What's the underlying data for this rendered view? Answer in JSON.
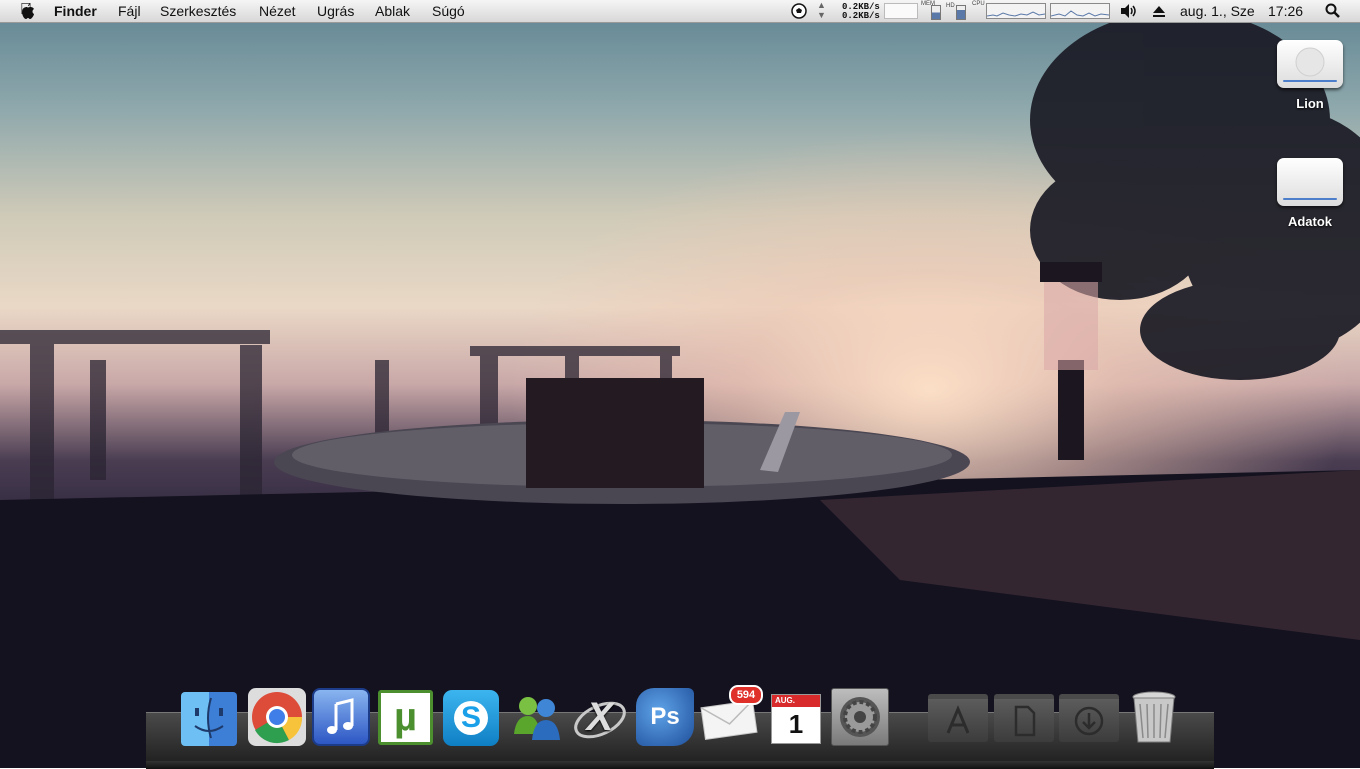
{
  "menubar": {
    "app_name": "Finder",
    "items": [
      "Fájl",
      "Szerkesztés",
      "Nézet",
      "Ugrás",
      "Ablak",
      "Súgó"
    ],
    "net_down": "0.2KB/s",
    "net_up": "0.2KB/s",
    "mem_label": "MEM",
    "hd_label": "HD",
    "cpu_label": "CPU",
    "date": "aug. 1., Sze",
    "time": "17:26"
  },
  "desktop": {
    "drives": [
      {
        "label": "Lion"
      },
      {
        "label": "Adatok"
      }
    ]
  },
  "dock": {
    "apps": [
      {
        "name": "Finder",
        "icon": "finder-icon"
      },
      {
        "name": "Google Chrome",
        "icon": "chrome-icon"
      },
      {
        "name": "iTunes",
        "icon": "itunes-icon"
      },
      {
        "name": "uTorrent",
        "icon": "utorrent-icon",
        "glyph": "µ"
      },
      {
        "name": "Skype",
        "icon": "skype-icon",
        "glyph": "S"
      },
      {
        "name": "Messenger",
        "icon": "messenger-icon"
      },
      {
        "name": "CrossOver",
        "icon": "crossover-icon",
        "glyph": "X"
      },
      {
        "name": "Photoshop",
        "icon": "photoshop-icon",
        "glyph": "Ps"
      },
      {
        "name": "Mail",
        "icon": "mail-icon",
        "badge": "594"
      },
      {
        "name": "iCal",
        "icon": "calendar-icon",
        "month": "AUG.",
        "day": "1"
      },
      {
        "name": "System Preferences",
        "icon": "gear-icon"
      }
    ],
    "stacks": [
      {
        "name": "Applications",
        "icon": "applications-folder-icon"
      },
      {
        "name": "Documents",
        "icon": "documents-folder-icon"
      },
      {
        "name": "Downloads",
        "icon": "downloads-folder-icon"
      }
    ],
    "trash": {
      "name": "Trash",
      "icon": "trash-icon"
    }
  },
  "colors": {
    "accent": "#2b6fd6",
    "badge": "#e0302a",
    "utorrent": "#4b8f2e",
    "skype": "#1aa0e8"
  }
}
